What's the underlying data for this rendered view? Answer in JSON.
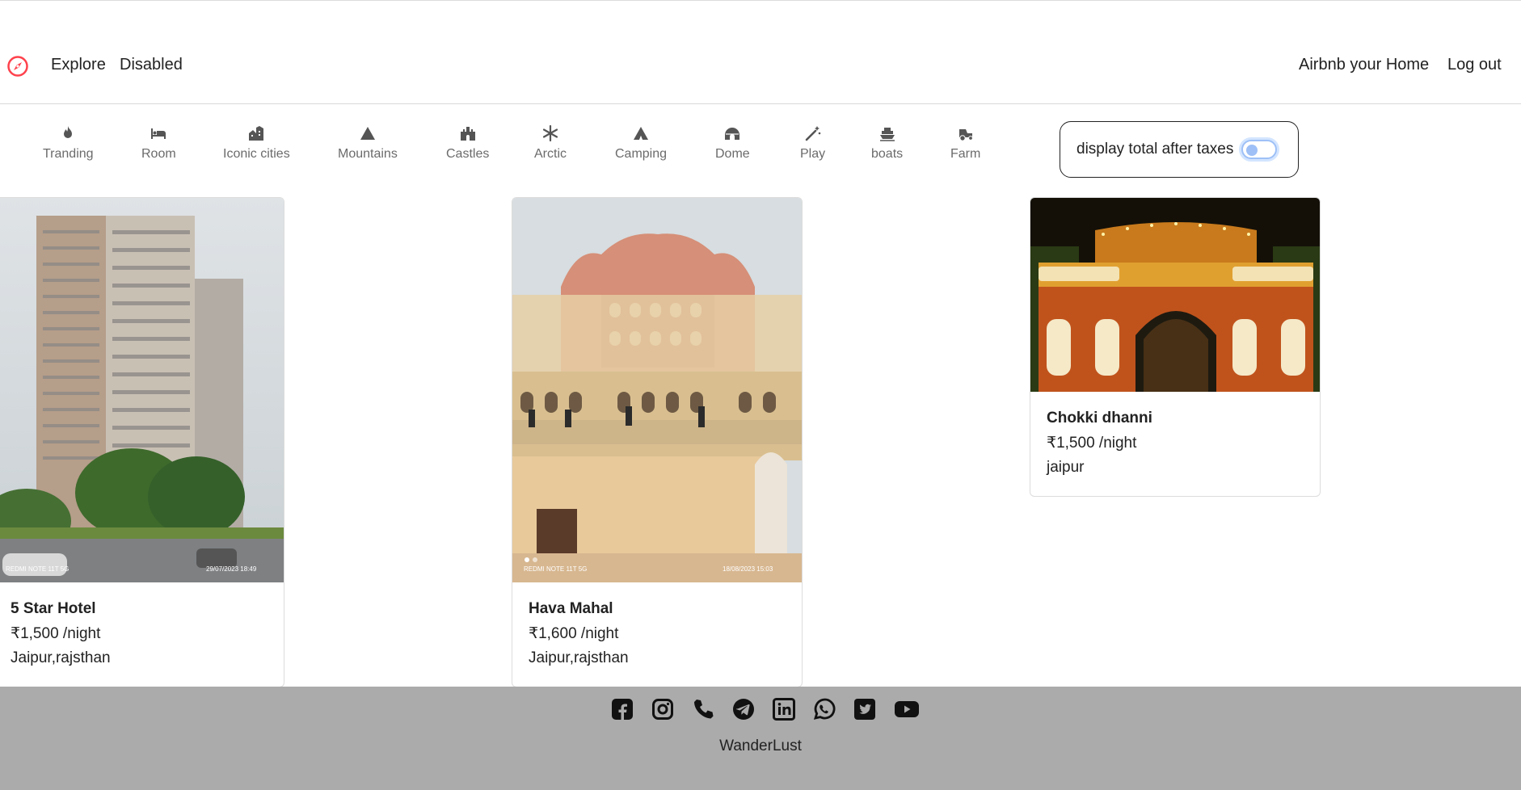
{
  "nav": {
    "brand_icon": "compass-icon",
    "brand_color": "#fe424d",
    "links": {
      "explore": "Explore",
      "disabled": "Disabled"
    },
    "right": {
      "airbnb": "Airbnb your Home",
      "logout": "Log out"
    }
  },
  "filters": [
    {
      "label": "Tranding",
      "icon": "fire-icon"
    },
    {
      "label": "Room",
      "icon": "bed-icon"
    },
    {
      "label": "Iconic cities",
      "icon": "city-icon"
    },
    {
      "label": "Mountains",
      "icon": "mountain-icon"
    },
    {
      "label": "Castles",
      "icon": "castle-icon"
    },
    {
      "label": "Arctic",
      "icon": "snowflake-icon"
    },
    {
      "label": "Camping",
      "icon": "tent-icon"
    },
    {
      "label": "Dome",
      "icon": "igloo-icon"
    },
    {
      "label": "Play",
      "icon": "magic-wand-icon"
    },
    {
      "label": "boats",
      "icon": "ship-icon"
    },
    {
      "label": "Farm",
      "icon": "tractor-icon"
    }
  ],
  "tax_toggle": {
    "label": "display total after taxes",
    "checked": false
  },
  "listings": [
    {
      "title": "5 Star Hotel",
      "price": "₹1,500 /night",
      "location": "Jaipur,rajsthan",
      "image_caption_left": "REDMI NOTE 11T 5G",
      "image_caption_right": "29/07/2023 18:49"
    },
    {
      "title": "Hava Mahal",
      "price": "₹1,600 /night",
      "location": "Jaipur,rajsthan",
      "image_caption_left": "REDMI NOTE 11T 5G",
      "image_caption_right": "18/08/2023 15:03"
    },
    {
      "title": "Chokki dhanni",
      "price": "₹1,500 /night",
      "location": "jaipur"
    }
  ],
  "footer": {
    "social": [
      "facebook-icon",
      "instagram-icon",
      "phone-icon",
      "telegram-icon",
      "linkedin-icon",
      "whatsapp-icon",
      "twitter-icon",
      "youtube-icon"
    ],
    "brand": "WanderLust"
  }
}
